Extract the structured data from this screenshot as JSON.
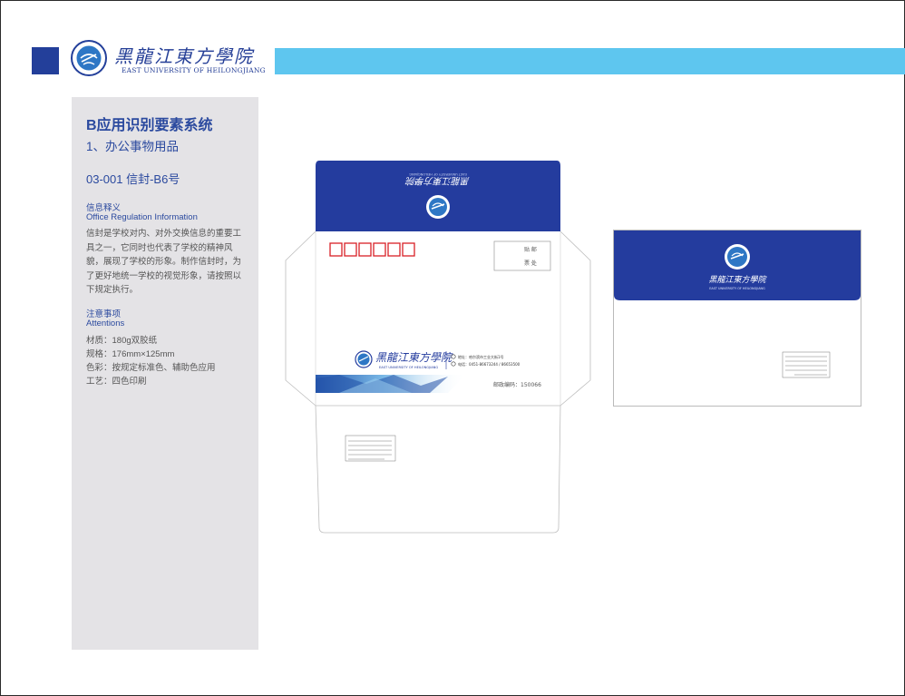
{
  "header": {
    "logo_cn": "黑龍江東方學院",
    "logo_en": "EAST UNIVERSITY OF HEILONGJIANG"
  },
  "sidebar": {
    "title": "B应用识别要素系统",
    "subtitle": "1、办公事物用品",
    "item_code": "03-001 信封-B6号",
    "info_heading_cn": "信息释义",
    "info_heading_en": "Office Regulation Information",
    "info_body": "信封是学校对内、对外交换信息的重要工具之一，它同时也代表了学校的精神风貌，展现了学校的形象。制作信封时，为了更好地统一学校的视觉形象，请按照以下规定执行。",
    "attention_heading_cn": "注意事项",
    "attention_heading_en": "Attentions",
    "specs": [
      "材质：180g双胶纸",
      "规格：176mm×125mm",
      "色彩：按规定标准色、辅助色应用",
      "工艺：四色印刷"
    ]
  },
  "envelope_front": {
    "stamp_label_1": "贴 邮",
    "stamp_label_2": "票 处",
    "logo_cn": "黑龍江東方學院",
    "logo_en": "EAST UNIVERSITY OF HEILONGJIANG",
    "address_line": "地址：哈尔滨市工业大街1号",
    "phone_line": "电话：0451-86673244 / 86653500",
    "postcode_text": "邮政编码：150066"
  },
  "envelope_back": {
    "logo_cn": "黑龍江東方學院",
    "logo_en": "EAST UNIVERSITY OF HEILONGJIANG"
  },
  "colors": {
    "brand_blue": "#243c9e",
    "light_blue_band": "#5ec6ef",
    "panel_gray": "#e4e3e6",
    "postcode_box_red": "#d82027"
  },
  "icons": [
    "university-seal-icon",
    "location-icon",
    "phone-icon"
  ]
}
